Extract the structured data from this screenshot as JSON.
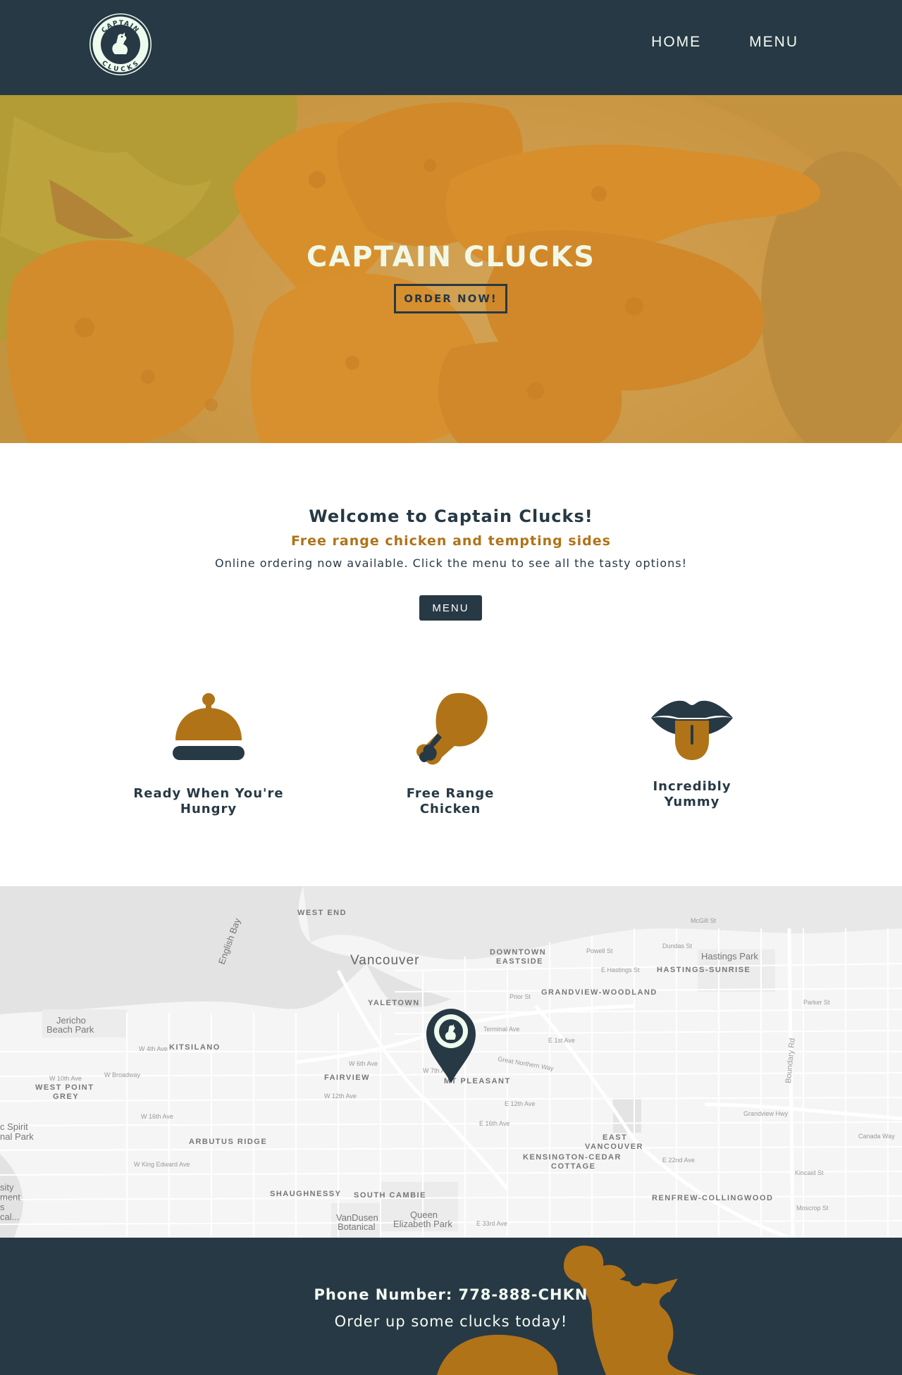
{
  "header": {
    "logo_text_top": "CAPTAIN",
    "logo_text_bottom": "CLUCKS",
    "nav": [
      {
        "label": "HOME"
      },
      {
        "label": "MENU"
      }
    ]
  },
  "hero": {
    "title": "CAPTAIN CLUCKS",
    "button": "ORDER NOW!"
  },
  "welcome": {
    "title": "Welcome to Captain Clucks!",
    "subtitle": "Free range chicken and tempting sides",
    "text": "Online ordering now available. Click the menu to see all the tasty options!",
    "button": "MENU"
  },
  "features": [
    {
      "icon": "service-bell-icon",
      "line1": "Ready When You're",
      "line2": "Hungry"
    },
    {
      "icon": "drumstick-icon",
      "line1": "Free Range",
      "line2": "Chicken"
    },
    {
      "icon": "tongue-icon",
      "line1": "Incredibly",
      "line2": "Yummy"
    }
  ],
  "map": {
    "labels": {
      "west_end": "WEST END",
      "vancouver": "Vancouver",
      "downtown_eastside_1": "DOWNTOWN",
      "downtown_eastside_2": "EASTSIDE",
      "hastings_park": "Hastings Park",
      "hastings_sunrise": "HASTINGS-SUNRISE",
      "english_bay": "English Bay",
      "yaletown": "YALETOWN",
      "grandview": "GRANDVIEW-WOODLAND",
      "jericho_1": "Jericho",
      "jericho_2": "Beach Park",
      "kitsilano": "KITSILANO",
      "fairview": "FAIRVIEW",
      "mt_pleasant": "MT PLEASANT",
      "west_point_grey_1": "WEST POINT",
      "west_point_grey_2": "GREY",
      "arbutus_ridge": "ARBUTUS RIDGE",
      "east_vancouver_1": "EAST",
      "east_vancouver_2": "VANCOUVER",
      "kensington_1": "KENSINGTON-CEDAR",
      "kensington_2": "COTTAGE",
      "shaughnessy": "SHAUGHNESSY",
      "south_cambie": "SOUTH CAMBIE",
      "renfrew": "RENFREW-COLLINGWOOD",
      "vandusen_1": "VanDusen",
      "vandusen_2": "Botanical",
      "queen_elizabeth_1": "Queen",
      "queen_elizabeth_2": "Elizabeth Park",
      "spirit_park_1": "c Spirit",
      "spirit_park_2": "nal Park",
      "left_edge_1": "sity",
      "left_edge_2": "ment",
      "left_edge_3": "s",
      "left_edge_4": "cal..."
    },
    "streets": {
      "powell": "Powell St",
      "dundas": "Dundas St",
      "e_hastings": "E Hastings St",
      "prior": "Prior St",
      "terminal": "Terminal Ave",
      "e_1st": "E 1st Ave",
      "w_4th": "W 4th Ave",
      "w_broadway": "W Broadway",
      "w_10th": "W 10th Ave",
      "w_12th": "W 12th Ave",
      "w_16th": "W 16th Ave",
      "e_12th": "E 12th Ave",
      "e_16th": "E 16th Ave",
      "w_king_edward": "W King Edward Ave",
      "grandview_hwy": "Grandview Hwy",
      "e_22nd": "E 22nd Ave",
      "e_33rd": "E 33rd Ave",
      "canada_way": "Canada Way",
      "kincaid": "Kincaid St",
      "moscrop": "Moscrop St",
      "parker": "Parker St",
      "mcgill": "McGill St",
      "boundary": "Boundary Rd",
      "great_northern": "Great Northern Way",
      "w_6th": "W 6th Ave",
      "w_7th": "W 7th Ave"
    },
    "pin_icon": "map-pin-logo-icon"
  },
  "footer": {
    "phone": "Phone Number: 778-888-CHKN",
    "tagline": "Order up some clucks today!"
  },
  "colors": {
    "navy": "#273944",
    "gold": "#b07318",
    "cream": "#f1f8e6"
  }
}
